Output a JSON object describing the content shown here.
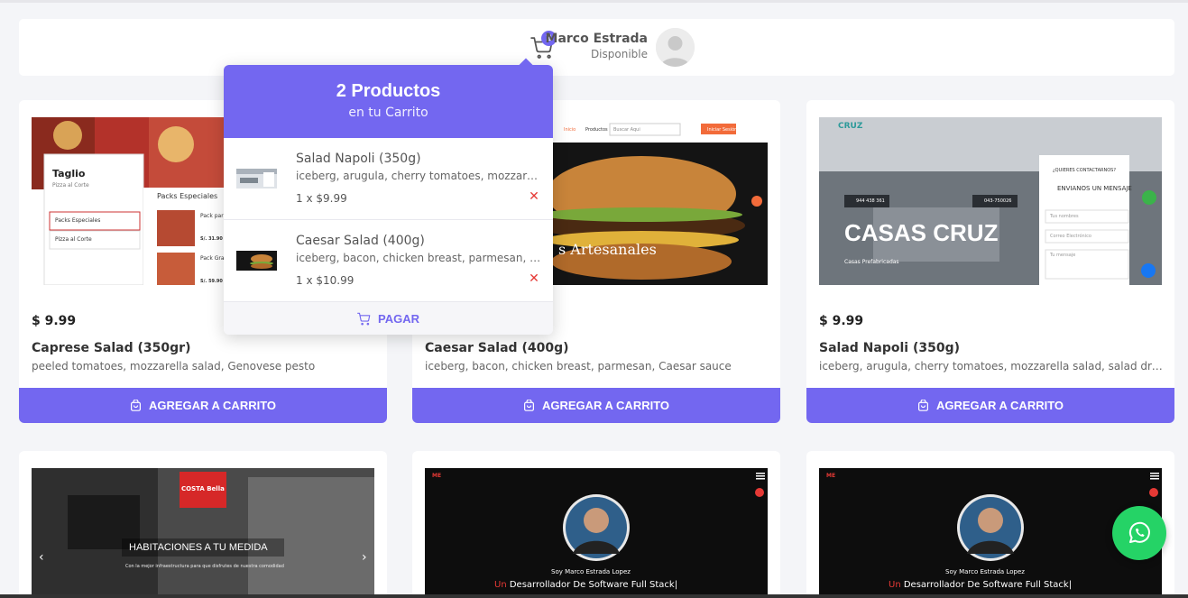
{
  "header": {
    "cart_count": "2",
    "user_name": "Marco Estrada",
    "user_status": "Disponible"
  },
  "cart_dropdown": {
    "title": "2 Productos",
    "subtitle": "en tu Carrito",
    "items": [
      {
        "name": "Salad Napoli (350g)",
        "description": "iceberg, arugula, cherry tomatoes, mozzarella salad, salad dressing",
        "qty_price": "1 x $9.99",
        "remove_icon": "x-icon"
      },
      {
        "name": "Caesar Salad (400g)",
        "description": "iceberg, bacon, chicken breast, parmesan, Caesar sauce",
        "qty_price": "1 x $10.99",
        "remove_icon": "x-icon"
      }
    ],
    "pay_label": "PAGAR"
  },
  "products": [
    {
      "price": "$ 9.99",
      "title": "Caprese Salad (350gr)",
      "description": "peeled tomatoes, mozzarella salad, Genovese pesto",
      "button": "AGREGAR A CARRITO",
      "thumb": {
        "brand": "Taglio",
        "tagline": "Pizza al Corte",
        "menu": [
          "Packs Especiales",
          "Pizza al Corte"
        ],
        "section": "Packs Especiales",
        "items": [
          {
            "name": "Pack para...",
            "price": "S/. 31.90"
          },
          {
            "name": "Pack Gran...",
            "price": "S/. 59.90"
          }
        ]
      }
    },
    {
      "price": "",
      "title": "Caesar Salad (400g)",
      "description": "iceberg, bacon, chicken breast, parmesan, Caesar sauce",
      "button": "AGREGAR A CARRITO",
      "thumb": {
        "nav": [
          "Inicio",
          "Productos"
        ],
        "search_placeholder": "Buscar Aqui",
        "cta": "Iniciar Sesión",
        "banner": "s Artesanales"
      }
    },
    {
      "price": "$ 9.99",
      "title": "Salad Napoli (350g)",
      "description": "iceberg, arugula, cherry tomatoes, mozzarella salad, salad dressing",
      "button": "AGREGAR A CARRITO",
      "thumb": {
        "logo": "CRUZ",
        "headline": "CASAS CRUZ",
        "sub": "Casas Prefabricadas",
        "phones": [
          "944 438 361",
          "043-750026"
        ],
        "form_top": "¿QUIERES CONTACTARNOS?",
        "form_title": "ENVIANOS UN MENSAJE",
        "fields": [
          "Tus nombres",
          "Correo Electrónico",
          "Tu mensaje"
        ]
      }
    },
    {
      "thumb": {
        "logo": "COSTA Bella",
        "headline": "HABITACIONES A TU MEDIDA",
        "sub": "Con la mejor infraestructura para que disfrutes de nuestra comodidad"
      }
    },
    {
      "thumb": {
        "logo": "ME",
        "intro": "Soy Marco Estrada Lopez",
        "accent_word": "Un",
        "role": "Desarrollador De Software Full Stack|"
      }
    },
    {
      "thumb": {
        "logo": "ME",
        "intro": "Soy Marco Estrada Lopez",
        "accent_word": "Un",
        "role": "Desarrollador De Software Full Stack|"
      }
    }
  ],
  "colors": {
    "accent": "#7367f0",
    "remove": "#e53935",
    "whatsapp": "#25d366"
  }
}
